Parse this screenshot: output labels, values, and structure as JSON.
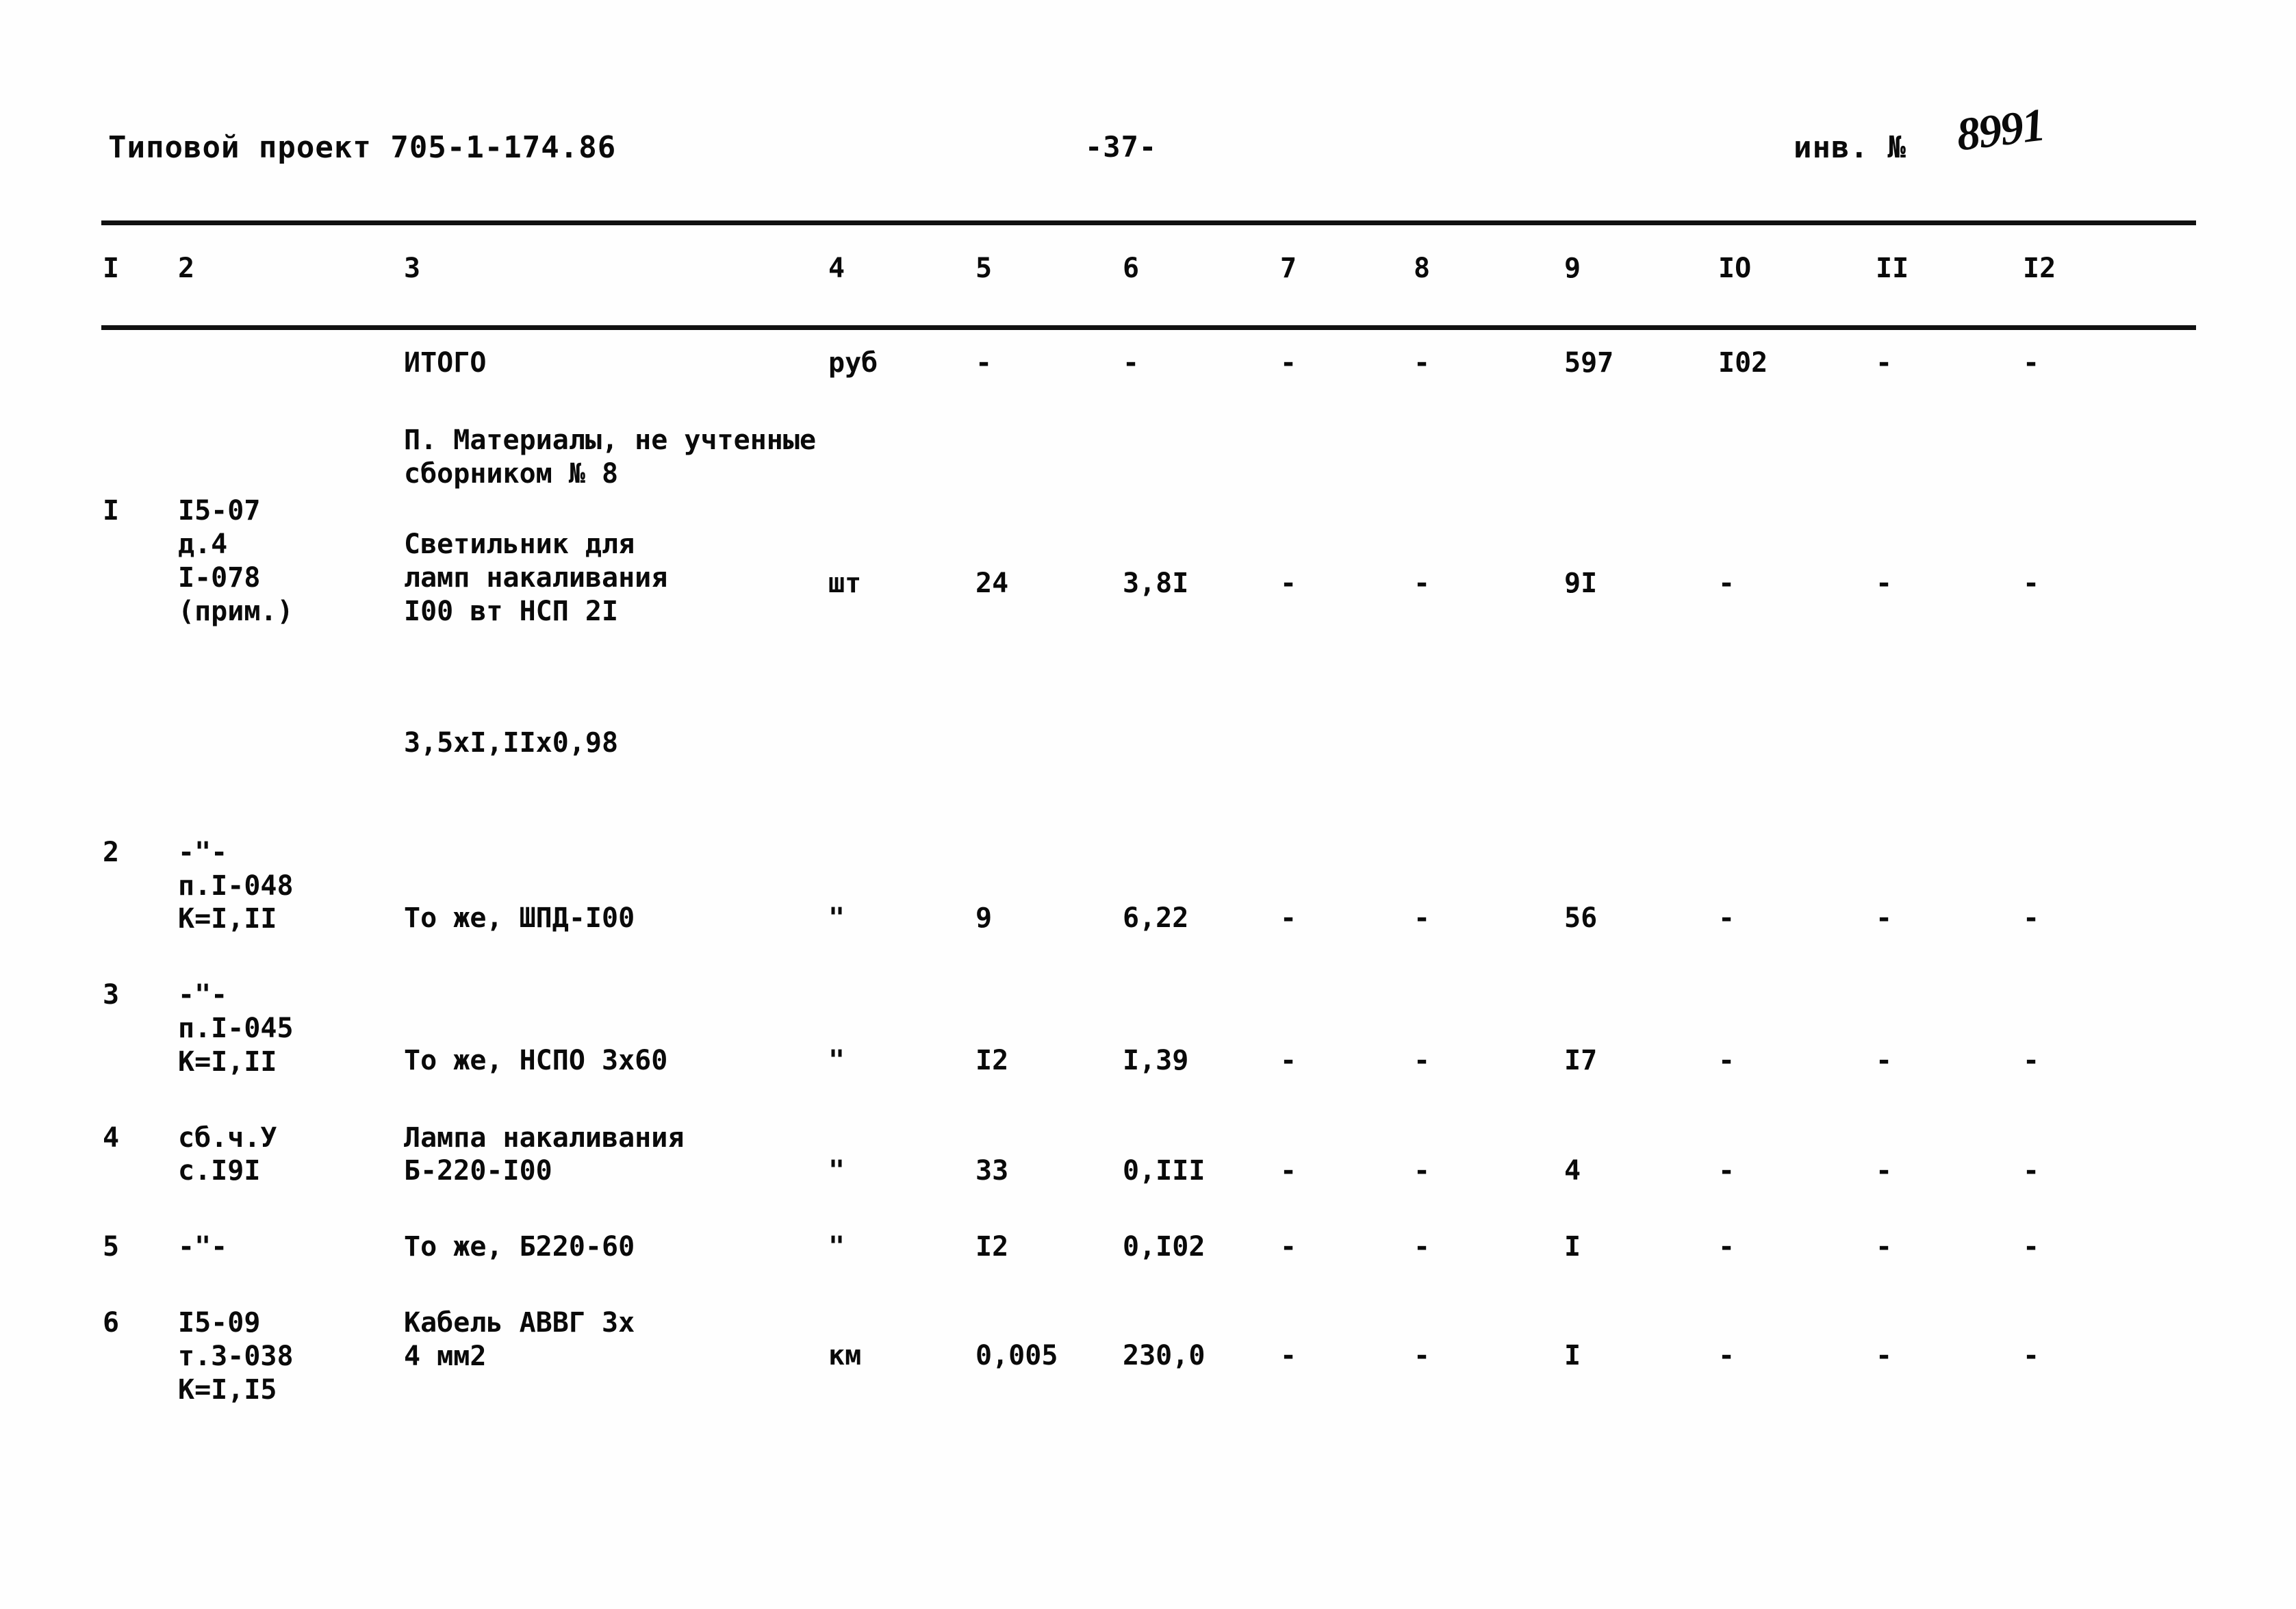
{
  "header": {
    "doc_title": "Типовой проект 705-1-174.86",
    "page_number": "-37-",
    "inv_label": "инв. №",
    "inv_number": "8991"
  },
  "table": {
    "column_numbers": [
      "I",
      "2",
      "3",
      "4",
      "5",
      "6",
      "7",
      "8",
      "9",
      "IO",
      "II",
      "I2"
    ],
    "total_row": {
      "label": "ИТОГО",
      "unit": "руб",
      "c5": "-",
      "c6": "-",
      "c7": "-",
      "c8": "-",
      "c9": "597",
      "c10": "I02",
      "c11": "-",
      "c12": "-"
    },
    "section_heading": "П. Материалы, не учтенные\n   сборником № 8",
    "rows": [
      {
        "no": "I",
        "code": "I5-07\nд.4\nI-078\n(прим.)",
        "name": "Светильник для\nламп накаливания\nI00 вт НСП 2I",
        "name_extra": "3,5xI,IIx0,98",
        "unit": "шт",
        "qty": "24",
        "price": "3,8I",
        "c7": "-",
        "c8": "-",
        "c9": "9I",
        "c10": "-",
        "c11": "-",
        "c12": "-"
      },
      {
        "no": "2",
        "code": "-\"-\nп.I-048\nК=I,II",
        "name": "То же, ШПД-I00",
        "name_extra": "",
        "unit": "\"",
        "qty": "9",
        "price": "6,22",
        "c7": "-",
        "c8": "-",
        "c9": "56",
        "c10": "-",
        "c11": "-",
        "c12": "-"
      },
      {
        "no": "3",
        "code": "-\"-\nп.I-045\nК=I,II",
        "name": "То же, НСПО 3x60",
        "name_extra": "",
        "unit": "\"",
        "qty": "I2",
        "price": "I,39",
        "c7": "-",
        "c8": "-",
        "c9": "I7",
        "c10": "-",
        "c11": "-",
        "c12": "-"
      },
      {
        "no": "4",
        "code": "сб.ч.У\nс.I9I",
        "name": "Лампа накаливания\nБ-220-I00",
        "name_extra": "",
        "unit": "\"",
        "qty": "33",
        "price": "0,III",
        "c7": "-",
        "c8": "-",
        "c9": "4",
        "c10": "-",
        "c11": "-",
        "c12": "-"
      },
      {
        "no": "5",
        "code": "-\"-",
        "name": "То же, Б220-60",
        "name_extra": "",
        "unit": "\"",
        "qty": "I2",
        "price": "0,I02",
        "c7": "-",
        "c8": "-",
        "c9": "I",
        "c10": "-",
        "c11": "-",
        "c12": "-"
      },
      {
        "no": "6",
        "code": "I5-09\nт.3-038\nК=I,I5",
        "name": "Кабель АВВГ 3x\n4 мм2",
        "name_extra": "",
        "unit": "км",
        "qty": "0,005",
        "price": "230,0",
        "c7": "-",
        "c8": "-",
        "c9": "I",
        "c10": "-",
        "c11": "-",
        "c12": "-"
      }
    ]
  }
}
